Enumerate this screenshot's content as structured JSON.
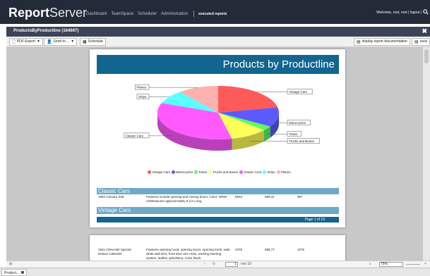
{
  "app": {
    "logo_bold": "Report",
    "logo_rest": "Server",
    "nav": [
      "Dashboard",
      "TeamSpace",
      "Scheduler",
      "Administration"
    ],
    "nav_active": "executed reports",
    "welcome": "Welcome, root, root | logout |"
  },
  "window": {
    "title": "ProductsByProductline (164667)",
    "close": "✖"
  },
  "toolbar": {
    "export_label": "PDF-Export",
    "send_label": "Send to ...",
    "schedule_label": "Schedule",
    "doc_label": "display report documentation",
    "save_label": "save"
  },
  "report": {
    "title": "Products by Productline",
    "section1": "Classic Cars",
    "section2": "Vintage Cars",
    "row1": {
      "name": "1982 Camaro Z28",
      "desc": "Features include opening and closing doors. Color: White. VinMeasures approximately 9 1/2 Long.",
      "qty": "6934",
      "price": "€89,41",
      "code": "997"
    },
    "row2": {
      "name": "1941 Chevrolet Special Deluxe Cabriolet",
      "desc": "Features opening hood, opening doors, opening trunk, wide white wall tires, front door arm rests, working steering system, leather upholstery. Color black.",
      "qty": "2378",
      "price": "€95,77",
      "code": "1076"
    },
    "page_label": "Page 1 of 19"
  },
  "chart_data": {
    "type": "pie",
    "title": "",
    "categories": [
      "Vintage Cars",
      "Motorcycles",
      "Trains",
      "Trucks and Buses",
      "Classic Cars",
      "Ships",
      "Planes"
    ],
    "values": [
      24,
      13,
      3,
      11,
      38,
      9,
      12
    ],
    "colors": [
      "#ff5a5a",
      "#5a5aff",
      "#5aff5a",
      "#ffff5a",
      "#ff5aff",
      "#5affff",
      "#ffb0b0"
    ],
    "legend_position": "bottom"
  },
  "pager": {
    "page_value": "1",
    "of_label": "von 19",
    "zoom": "75%"
  },
  "taskbar": {
    "tab_label": "Product...",
    "tab_close": "✖"
  }
}
